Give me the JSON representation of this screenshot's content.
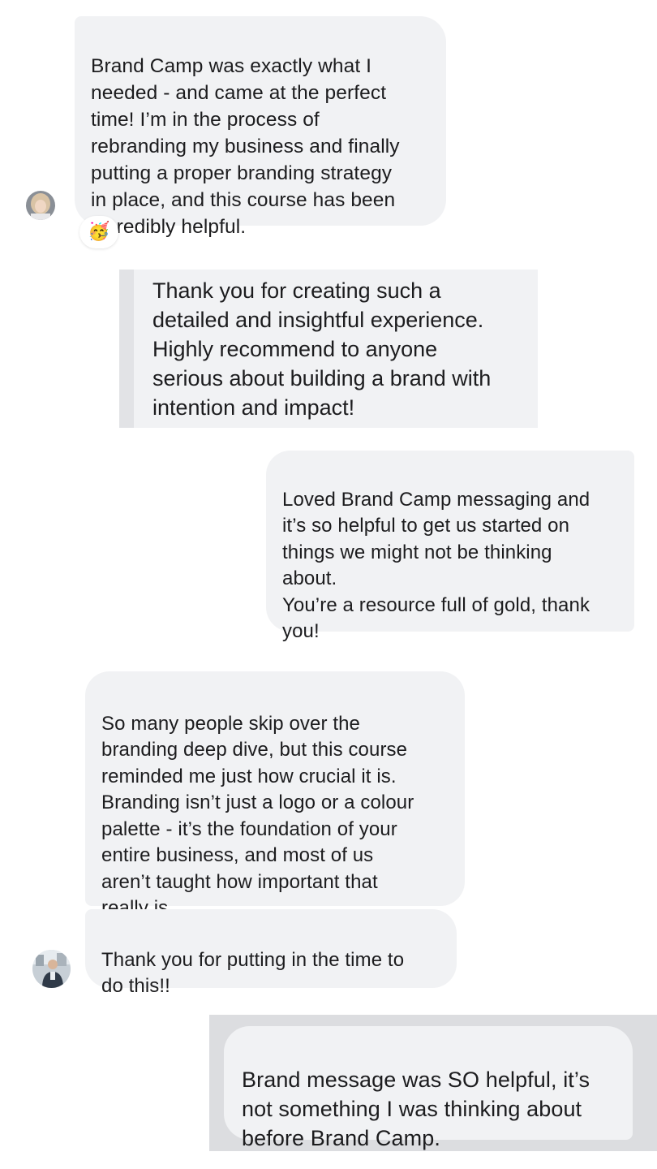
{
  "messages": [
    {
      "text": "Brand Camp was exactly what I\nneeded - and came at the perfect\ntime! I’m in the process of\nrebranding my business and finally\nputting a proper branding strategy\nin place, and this course has been\nincredibly helpful.",
      "reaction": "🥳"
    },
    {
      "text": "Thank you for creating such a\ndetailed and insightful experience.\nHighly recommend to anyone\nserious about building a brand with\nintention and impact!"
    },
    {
      "text": "Loved Brand Camp messaging and\nit’s so helpful to get us started on\nthings we might not be thinking\nabout.\nYou’re a resource full of gold, thank\nyou!"
    },
    {
      "text": "So many people skip over the\nbranding deep dive, but this course\nreminded me just how crucial it is.\nBranding isn’t just a logo or a colour\npalette - it’s the foundation of your\nentire business, and most of us\naren’t taught how important that\nreally is."
    },
    {
      "text": "Thank you for putting in the time to\ndo this!!"
    },
    {
      "text": "Brand message was SO helpful, it’s\nnot something I was thinking about\nbefore Brand Camp."
    }
  ],
  "colors": {
    "bubble": "#f1f2f4",
    "text": "#1c1c1e"
  }
}
